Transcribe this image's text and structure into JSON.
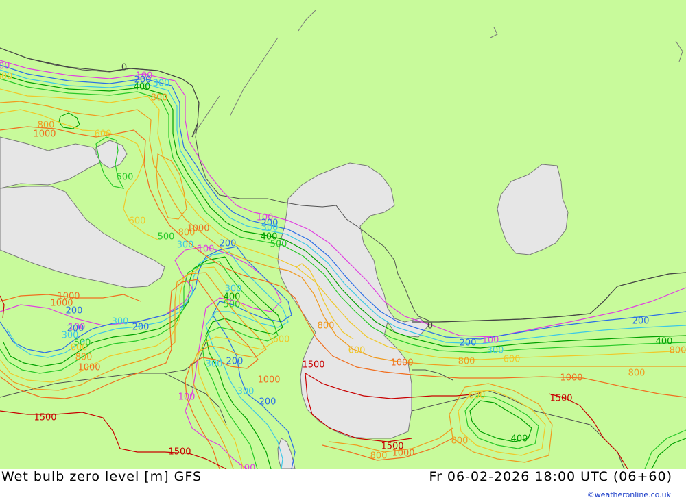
{
  "footer": {
    "title": "Wet bulb zero level [m] GFS",
    "datetime": "Fr 06-02-2026 18:00 UTC (06+60)",
    "credit": "©weatheronline.co.uk"
  },
  "colors": {
    "land": "#c8fa9b",
    "sea": "#e6e6e6",
    "border": "#505050",
    "coast": "#787878"
  },
  "contour_colors": {
    "0": "#444444",
    "100": "#e040e0",
    "200": "#2a6ee6",
    "300": "#3cc8e6",
    "400": "#00a000",
    "500": "#28c828",
    "600": "#f0c828",
    "800": "#f09a1e",
    "1000": "#f06e1e",
    "1500": "#c80000"
  },
  "contour_labels": [
    {
      "text": "0",
      "level": "0"
    },
    {
      "text": "0",
      "level": "0"
    },
    {
      "text": "100",
      "level": "100"
    },
    {
      "text": "100",
      "level": "100"
    },
    {
      "text": "100",
      "level": "100"
    },
    {
      "text": "100",
      "level": "100"
    },
    {
      "text": "100",
      "level": "100"
    },
    {
      "text": "100",
      "level": "100"
    },
    {
      "text": "100",
      "level": "100"
    },
    {
      "text": "100",
      "level": "100"
    },
    {
      "text": "200",
      "level": "200"
    },
    {
      "text": "200",
      "level": "200"
    },
    {
      "text": "200",
      "level": "200"
    },
    {
      "text": "200",
      "level": "200"
    },
    {
      "text": "200",
      "level": "200"
    },
    {
      "text": "200",
      "level": "200"
    },
    {
      "text": "200",
      "level": "200"
    },
    {
      "text": "200",
      "level": "200"
    },
    {
      "text": "200",
      "level": "200"
    },
    {
      "text": "200",
      "level": "200"
    },
    {
      "text": "300",
      "level": "300"
    },
    {
      "text": "300",
      "level": "300"
    },
    {
      "text": "300",
      "level": "300"
    },
    {
      "text": "300",
      "level": "300"
    },
    {
      "text": "300",
      "level": "300"
    },
    {
      "text": "300",
      "level": "300"
    },
    {
      "text": "300",
      "level": "300"
    },
    {
      "text": "300",
      "level": "300"
    },
    {
      "text": "300",
      "level": "300"
    },
    {
      "text": "400",
      "level": "400"
    },
    {
      "text": "400",
      "level": "400"
    },
    {
      "text": "400",
      "level": "400"
    },
    {
      "text": "400",
      "level": "400"
    },
    {
      "text": "400",
      "level": "400"
    },
    {
      "text": "500",
      "level": "500"
    },
    {
      "text": "500",
      "level": "500"
    },
    {
      "text": "500",
      "level": "500"
    },
    {
      "text": "500",
      "level": "500"
    },
    {
      "text": "500",
      "level": "500"
    },
    {
      "text": "600",
      "level": "600"
    },
    {
      "text": "600",
      "level": "600"
    },
    {
      "text": "600",
      "level": "600"
    },
    {
      "text": "600",
      "level": "600"
    },
    {
      "text": "600",
      "level": "600"
    },
    {
      "text": "600",
      "level": "600"
    },
    {
      "text": "600",
      "level": "600"
    },
    {
      "text": "600",
      "level": "600"
    },
    {
      "text": "800",
      "level": "800"
    },
    {
      "text": "800",
      "level": "800"
    },
    {
      "text": "800",
      "level": "800"
    },
    {
      "text": "800",
      "level": "800"
    },
    {
      "text": "800",
      "level": "800"
    },
    {
      "text": "800",
      "level": "800"
    },
    {
      "text": "800",
      "level": "800"
    },
    {
      "text": "800",
      "level": "800"
    },
    {
      "text": "800",
      "level": "800"
    },
    {
      "text": "800",
      "level": "800"
    },
    {
      "text": "1000",
      "level": "1000"
    },
    {
      "text": "1000",
      "level": "1000"
    },
    {
      "text": "1000",
      "level": "1000"
    },
    {
      "text": "1000",
      "level": "1000"
    },
    {
      "text": "1000",
      "level": "1000"
    },
    {
      "text": "1000",
      "level": "1000"
    },
    {
      "text": "1000",
      "level": "1000"
    },
    {
      "text": "1000",
      "level": "1000"
    },
    {
      "text": "1000",
      "level": "1000"
    },
    {
      "text": "1500",
      "level": "1500"
    },
    {
      "text": "1500",
      "level": "1500"
    },
    {
      "text": "1500",
      "level": "1500"
    },
    {
      "text": "1500",
      "level": "1500"
    },
    {
      "text": "1500",
      "level": "1500"
    }
  ]
}
